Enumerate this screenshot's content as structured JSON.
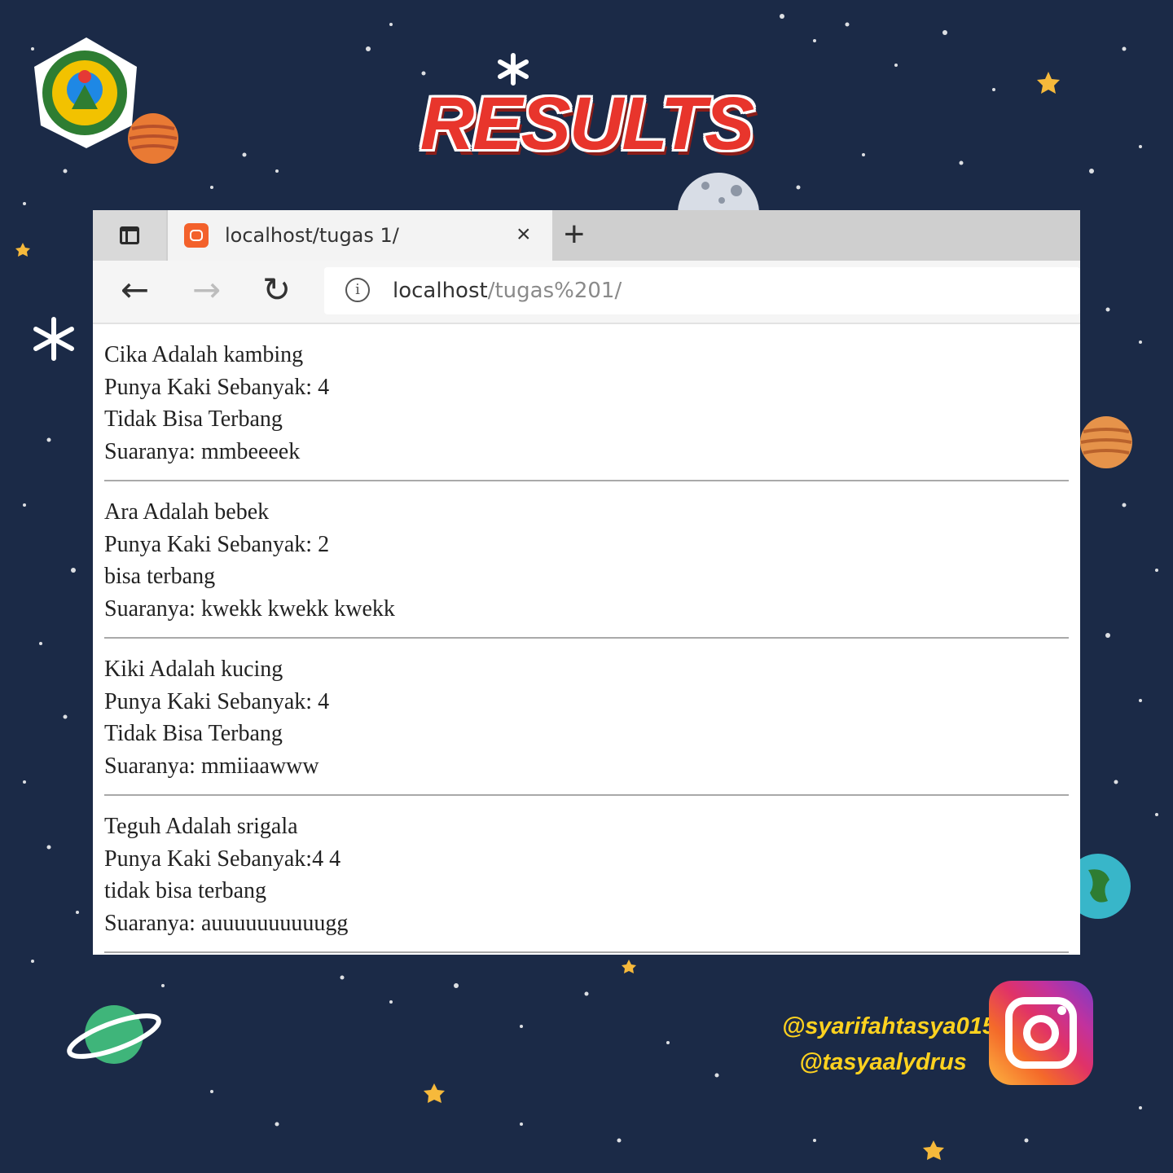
{
  "header": {
    "title": "RESULTS"
  },
  "browser": {
    "tab": {
      "title": "localhost/tugas 1/",
      "close": "×"
    },
    "new_tab": "+",
    "address": {
      "host": "localhost",
      "path": "/tugas%201/"
    }
  },
  "animals": [
    {
      "line1": "Cika Adalah kambing",
      "line2": "Punya Kaki Sebanyak: 4",
      "line3": "Tidak Bisa Terbang",
      "line4": "Suaranya: mmbeeeek"
    },
    {
      "line1": "Ara Adalah bebek",
      "line2": "Punya Kaki Sebanyak: 2",
      "line3": "bisa terbang",
      "line4": "Suaranya: kwekk kwekk kwekk"
    },
    {
      "line1": "Kiki Adalah kucing",
      "line2": "Punya Kaki Sebanyak: 4",
      "line3": "Tidak Bisa Terbang",
      "line4": "Suaranya: mmiiaawww"
    },
    {
      "line1": "Teguh Adalah srigala",
      "line2": "Punya Kaki Sebanyak:4 4",
      "line3": "tidak bisa terbang",
      "line4": "Suaranya: auuuuuuuuuugg"
    }
  ],
  "social": {
    "handle1": "@syarifahtasya015",
    "handle2": "@tasyaalydrus"
  },
  "colors": {
    "background": "#1b2a47",
    "title_red": "#e8352c",
    "handle_yellow": "#ffd21f"
  }
}
